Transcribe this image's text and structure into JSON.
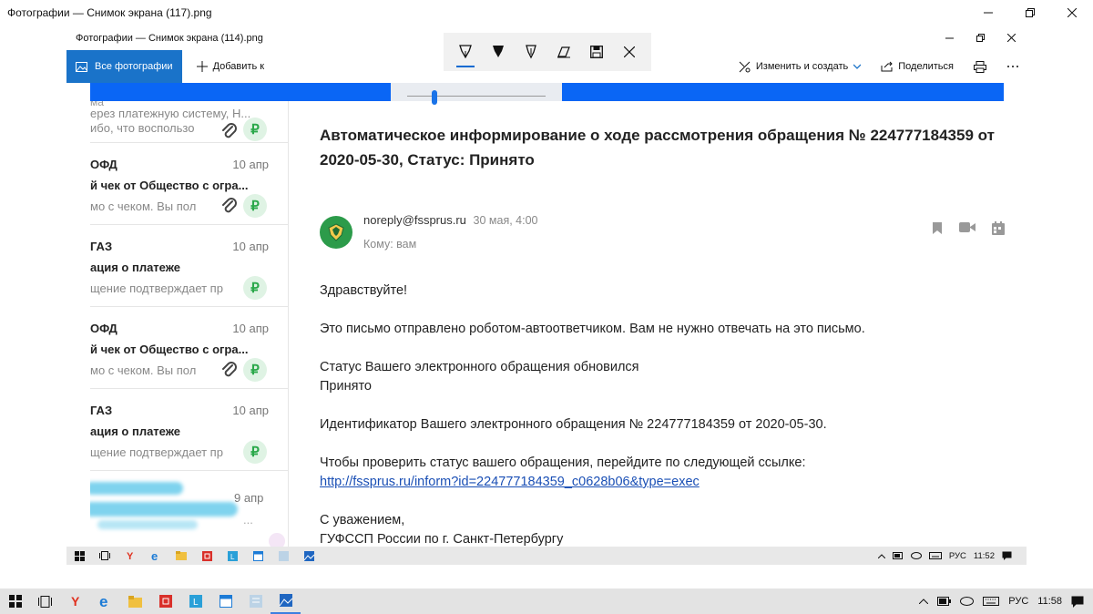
{
  "outer_window": {
    "title": "Фотографии — Снимок экрана (117).png"
  },
  "inner_window": {
    "title": "Фотографии — Снимок экрана (114).png",
    "all_photos_label": "Все фотографии",
    "add_to_label": "Добавить к",
    "edit_create_label": "Изменить и создать",
    "share_label": "Поделиться"
  },
  "email_list": {
    "first_item": {
      "cut_text": "ма",
      "subject": "ерез платежную систему, Н...",
      "preview": "ибо, что воспользо"
    },
    "items": [
      {
        "sender": "ОФД",
        "date": "10 апр",
        "subject": "й чек от Общество с огра...",
        "preview": "мо с чеком. Вы пол",
        "has_clip": true
      },
      {
        "sender": "ГАЗ",
        "date": "10 апр",
        "subject": "ация о платеже",
        "preview": "щение подтверждает пр",
        "has_clip": false
      },
      {
        "sender": "ОФД",
        "date": "10 апр",
        "subject": "й чек от Общество с огра...",
        "preview": "мо с чеком. Вы пол",
        "has_clip": true
      },
      {
        "sender": "ГАЗ",
        "date": "10 апр",
        "subject": "ация о платеже",
        "preview": "щение подтверждает пр",
        "has_clip": false
      }
    ],
    "last_item": {
      "date": "9 апр",
      "ghost_text": "..."
    },
    "ruble_glyph": "₽"
  },
  "email": {
    "subject": "Автоматическое информирование о ходе рассмотрения обращения № 224777184359 от 2020-05-30, Статус: Принято",
    "sender": "noreply@fssprus.ru",
    "date": "30 мая, 4:00",
    "recipient": "Кому: вам",
    "greeting": "Здравствуйте!",
    "robot_notice": "Это письмо отправлено роботом-автоответчиком. Вам не нужно отвечать на это письмо.",
    "status_line": "Статус Вашего электронного обращения обновился",
    "status_value": "Принято",
    "identifier_line": "Идентификатор Вашего электронного обращения № 224777184359 от 2020-05-30.",
    "check_line": "Чтобы проверить статус вашего обращения, перейдите по следующей ссылке:",
    "link": "http://fssprus.ru/inform?id=224777184359_c0628b06&type=exec",
    "regards": "С уважением,",
    "signature": "ГУФССП России по г. Санкт-Петербургу"
  },
  "inner_taskbar": {
    "lang": "РУС",
    "time": "11:52"
  },
  "taskbar": {
    "lang": "РУС",
    "time": "11:58"
  },
  "colors": {
    "accent": "#1a73c9",
    "band_blue": "#0a66f5",
    "link": "#1a4fb5",
    "ruble_green": "#2aa84a",
    "avatar_green": "#2c9b4a"
  }
}
